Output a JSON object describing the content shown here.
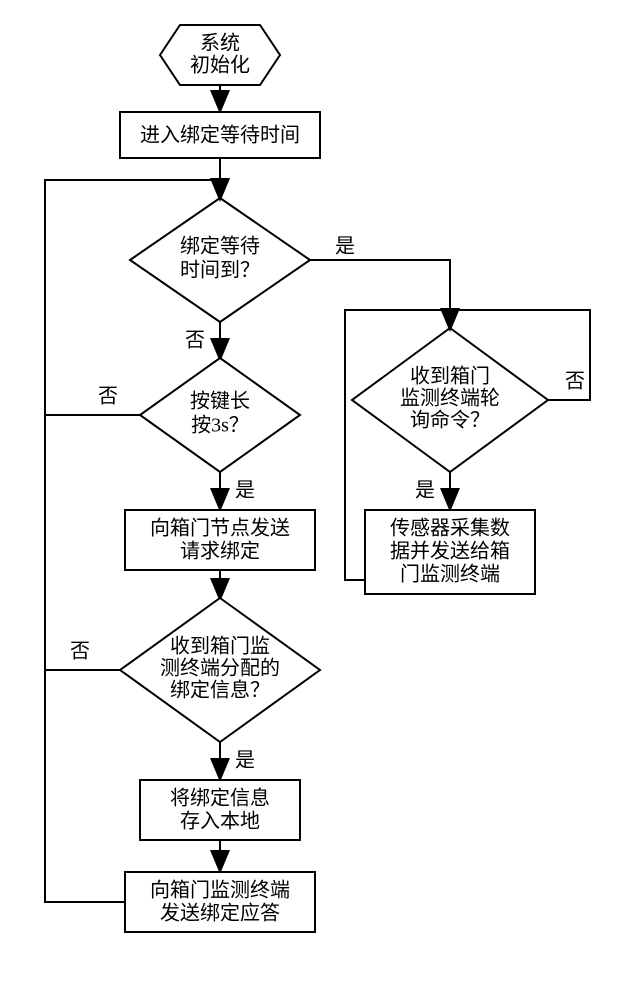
{
  "nodes": {
    "n1": {
      "lines": [
        "系统",
        "初始化"
      ]
    },
    "n2": {
      "lines": [
        "进入绑定等待时间"
      ]
    },
    "d1": {
      "lines": [
        "绑定等待",
        "时间到？"
      ]
    },
    "d2": {
      "lines": [
        "按键长",
        "按3s？"
      ]
    },
    "n3": {
      "lines": [
        "向箱门节点发送",
        "请求绑定"
      ]
    },
    "d3": {
      "lines": [
        "收到箱门监",
        "测终端分配的",
        "绑定信息？"
      ]
    },
    "n4": {
      "lines": [
        "将绑定信息",
        "存入本地"
      ]
    },
    "n5": {
      "lines": [
        "向箱门监测终端",
        "发送绑定应答"
      ]
    },
    "d4": {
      "lines": [
        "收到箱门",
        "监测终端轮",
        "询命令？"
      ]
    },
    "n6": {
      "lines": [
        "传感器采集数",
        "据并发送给箱",
        "门监测终端"
      ]
    }
  },
  "labels": {
    "yes": "是",
    "no": "否"
  }
}
